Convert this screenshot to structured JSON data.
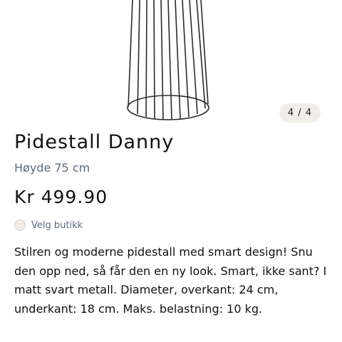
{
  "gallery": {
    "counter": "4 / 4"
  },
  "product": {
    "title": "Pidestall Danny",
    "subtitle": "Høyde 75 cm",
    "price": "Kr 499.90",
    "store_label": "Velg butikk",
    "description": "Stilren og moderne pidestall med smart design! Snu den opp ned, så får den en ny look. Smart, ikke sant? I matt svart metall. Diameter, overkant: 24 cm, underkant: 18 cm. Maks. belastning: 10 kg."
  },
  "icons": {
    "store": "store-status-dot"
  },
  "colors": {
    "accent_bg": "#f1ede9",
    "muted_text": "#5f6b7a"
  }
}
